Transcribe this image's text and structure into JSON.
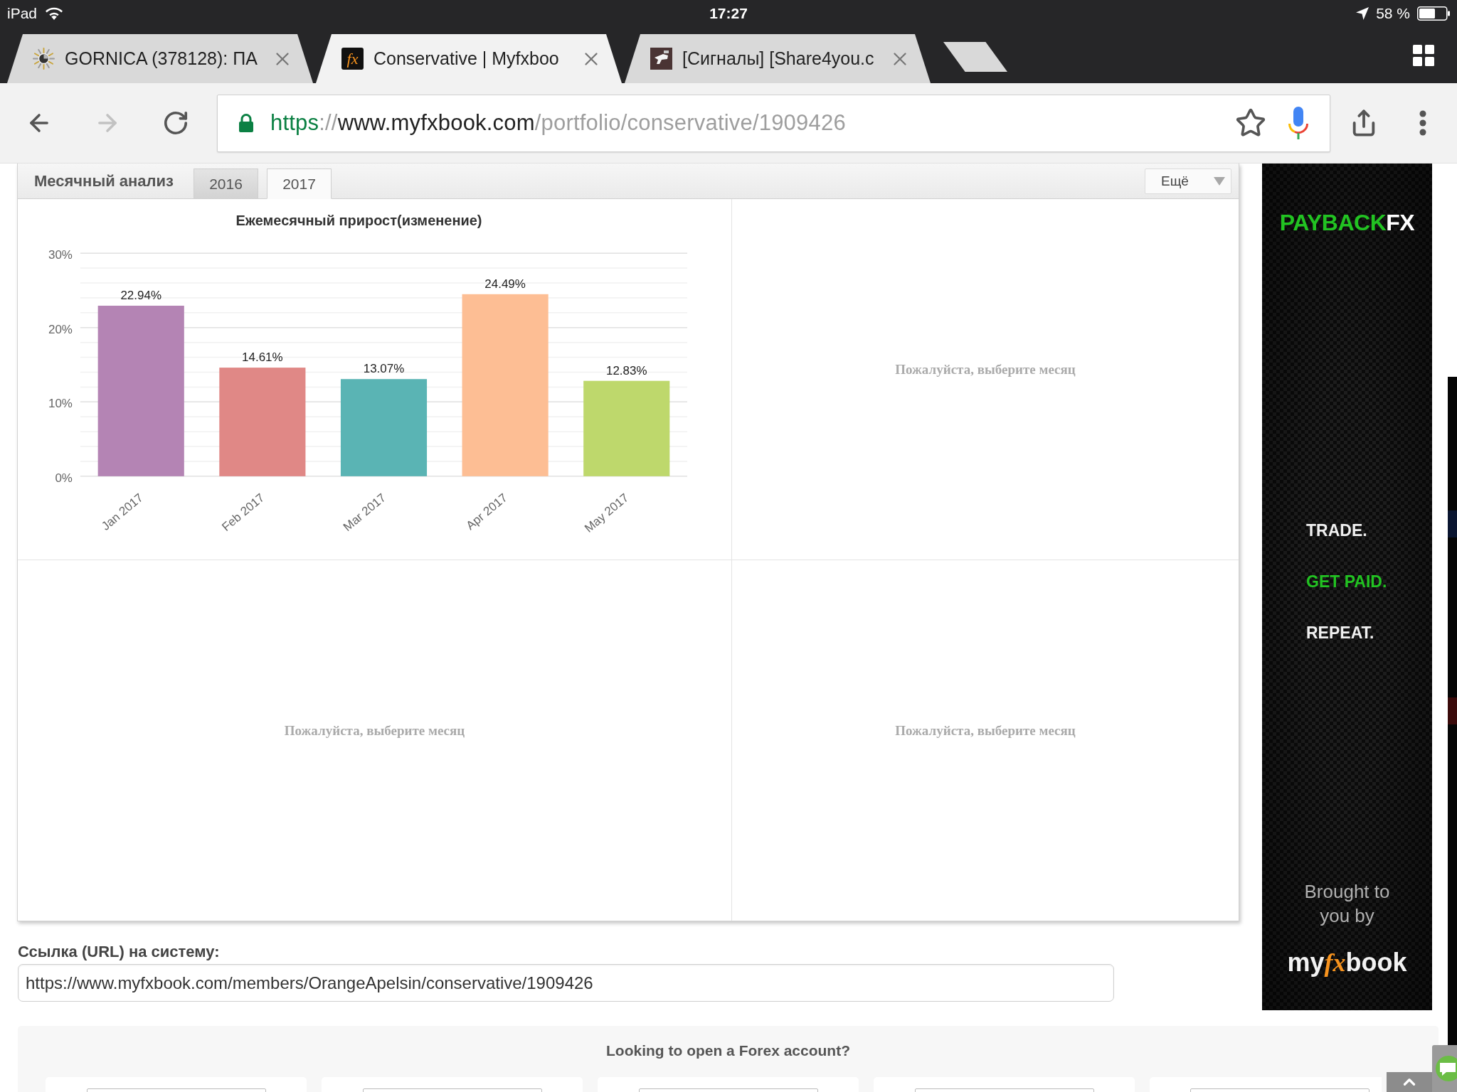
{
  "status_bar": {
    "device": "iPad",
    "time": "17:27",
    "battery": "58 %"
  },
  "browser_tabs": [
    {
      "title": "GORNICA (378128): ПА",
      "kind": "sun",
      "selected": false
    },
    {
      "title": "Conservative | Myfxboo",
      "kind": "logo",
      "favicon_text": "fx",
      "selected": true
    },
    {
      "title": "[Сигналы] [Share4you.c",
      "kind": "picture",
      "selected": false
    }
  ],
  "toolbar": {
    "buttons": [
      {
        "kind": "back",
        "disabled": false
      },
      {
        "kind": "forward",
        "disabled": true
      },
      {
        "kind": "reload",
        "disabled": false
      }
    ]
  },
  "address_bar": {
    "url_parts": [
      {
        "kind": "scheme",
        "text": "https"
      },
      {
        "kind": "punct",
        "text": "://"
      },
      {
        "kind": "host",
        "text": "www.myfxbook.com"
      },
      {
        "kind": "path",
        "text": "/portfolio/conservative/1909426"
      }
    ]
  },
  "panel": {
    "title": "Месячный анализ",
    "tabs": [
      {
        "label": "2016",
        "selected": false
      },
      {
        "label": "2017",
        "selected": true
      }
    ],
    "more_button": "Ещё",
    "cells": [
      {
        "kind": "chart",
        "chart_data": {
          "type": "bar",
          "title": "Ежемесячный прирост(изменение)",
          "categories": [
            "Jan 2017",
            "Feb 2017",
            "Mar 2017",
            "Apr 2017",
            "May 2017"
          ],
          "values": [
            22.94,
            14.61,
            13.07,
            24.49,
            12.83
          ],
          "colors": [
            "#b484b4",
            "#e08886",
            "#5ab4b4",
            "#fdbe94",
            "#bed86c"
          ],
          "value_labels": [
            "22.94%",
            "14.61%",
            "13.07%",
            "24.49%",
            "12.83%"
          ],
          "ylim": [
            0,
            30
          ],
          "yticks": [
            {
              "value": 0,
              "label": "0%"
            },
            {
              "value": 10,
              "label": "10%"
            },
            {
              "value": 20,
              "label": "20%"
            },
            {
              "value": 30,
              "label": "30%"
            }
          ],
          "grid": true
        }
      },
      {
        "kind": "message",
        "text": "Пожалуйста, выберите месяц"
      },
      {
        "kind": "message",
        "text": "Пожалуйста, выберите месяц"
      },
      {
        "kind": "message",
        "text": "Пожалуйста, выберите месяц"
      }
    ]
  },
  "url_section": {
    "label": "Ссылка (URL) на систему:",
    "value": "https://www.myfxbook.com/members/OrangeApelsin/conservative/1909426"
  },
  "ad": {
    "brand": [
      {
        "text": "PAYBACK",
        "accent": true
      },
      {
        "text": "FX",
        "accent": false
      }
    ],
    "slogan": [
      {
        "text": "TRADE.",
        "accent": false
      },
      {
        "text": "GET PAID.",
        "accent": true
      },
      {
        "text": "REPEAT.",
        "accent": false
      }
    ],
    "credit": "Brought to you by",
    "logo": [
      {
        "text": "my",
        "accent": false
      },
      {
        "text": "fx",
        "accent": true
      },
      {
        "text": "book",
        "accent": false
      }
    ]
  },
  "forex_offer": {
    "title": "Looking to open a Forex account?"
  }
}
